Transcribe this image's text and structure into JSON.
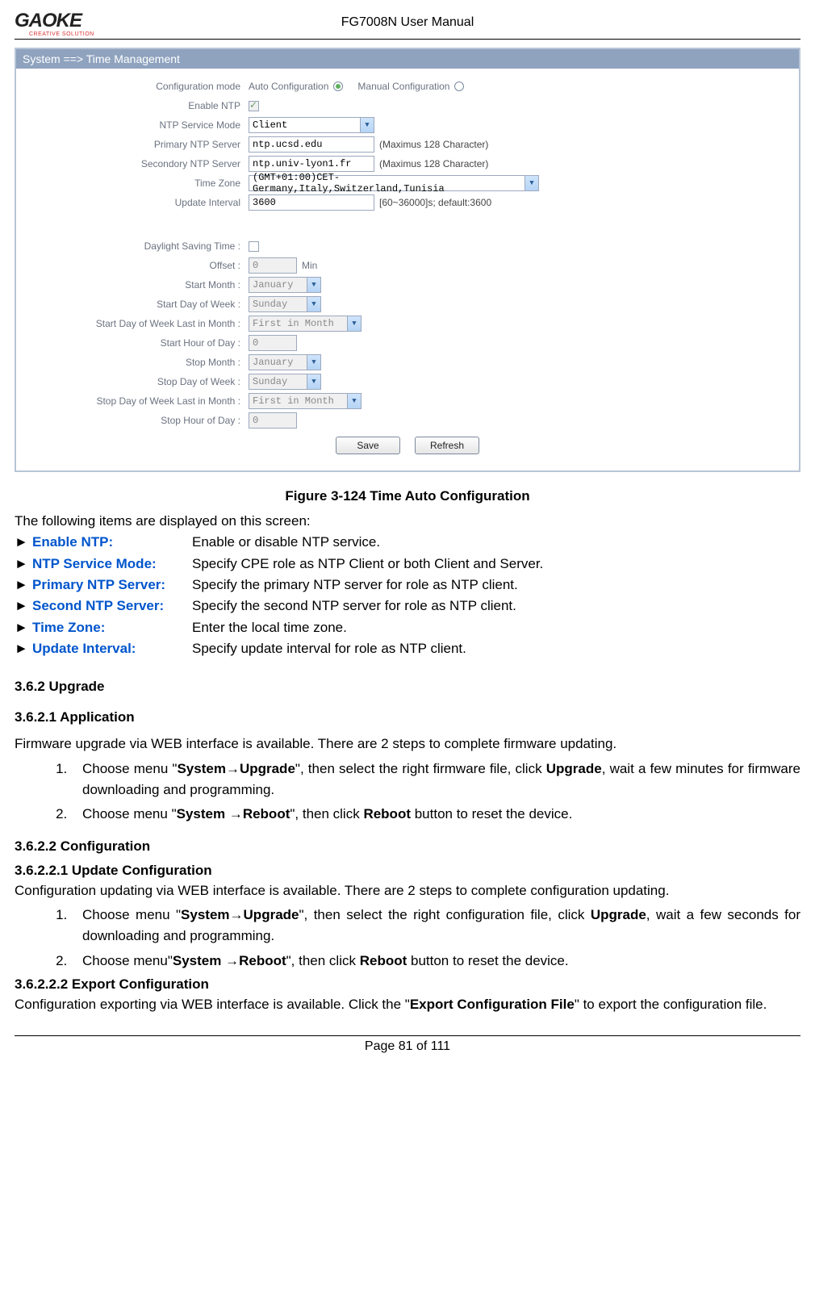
{
  "header": {
    "logo_main": "GAOKE",
    "logo_tag": "CREATIVE SOLUTION",
    "doc_title": "FG7008N User Manual"
  },
  "screenshot": {
    "titlebar": "System ==> Time Management",
    "rows": {
      "config_mode_label": "Configuration mode",
      "config_mode_opt1": "Auto Configuration",
      "config_mode_opt2": "Manual Configuration",
      "enable_ntp_label": "Enable NTP",
      "ntp_service_mode_label": "NTP Service Mode",
      "ntp_service_mode_value": "Client",
      "primary_ntp_label": "Primary NTP Server",
      "primary_ntp_value": "ntp.ucsd.edu",
      "primary_ntp_hint": "(Maximus 128 Character)",
      "secondary_ntp_label": "Secondory NTP Server",
      "secondary_ntp_value": "ntp.univ-lyon1.fr",
      "secondary_ntp_hint": "(Maximus 128 Character)",
      "timezone_label": "Time Zone",
      "timezone_value": "(GMT+01:00)CET-Germany,Italy,Switzerland,Tunisia",
      "update_interval_label": "Update Interval",
      "update_interval_value": "3600",
      "update_interval_hint": "[60~36000]s; default:3600",
      "dst_label": "Daylight Saving Time :",
      "offset_label": "Offset :",
      "offset_value": "0",
      "offset_unit": "Min",
      "start_month_label": "Start Month :",
      "start_month_value": "January",
      "start_dow_label": "Start Day of Week :",
      "start_dow_value": "Sunday",
      "start_dow_last_label": "Start Day of Week Last in Month :",
      "start_dow_last_value": "First in Month",
      "start_hour_label": "Start Hour of Day :",
      "start_hour_value": "0",
      "stop_month_label": "Stop Month :",
      "stop_month_value": "January",
      "stop_dow_label": "Stop Day of Week :",
      "stop_dow_value": "Sunday",
      "stop_dow_last_label": "Stop Day of Week Last in Month :",
      "stop_dow_last_value": "First in Month",
      "stop_hour_label": "Stop Hour of Day :",
      "stop_hour_value": "0"
    },
    "buttons": {
      "save": "Save",
      "refresh": "Refresh"
    }
  },
  "figure_caption": "Figure 3-124  Time Auto Configuration",
  "intro_line": "The following items are displayed on this screen:",
  "params": [
    {
      "name": "Enable NTP:",
      "desc": "Enable or disable NTP service."
    },
    {
      "name": "NTP Service Mode:",
      "desc": "Specify CPE role as NTP Client or both Client and Server."
    },
    {
      "name": "Primary NTP Server:",
      "desc": "Specify the primary NTP server for role as NTP client."
    },
    {
      "name": "Second NTP Server:",
      "desc": "Specify the second NTP server for role as NTP client."
    },
    {
      "name": "Time Zone:",
      "desc": "Enter the local time zone."
    },
    {
      "name": "Update Interval:",
      "desc": "Specify update interval for role as NTP client."
    }
  ],
  "sections": {
    "s362": "3.6.2    Upgrade",
    "s3621": "3.6.2.1      Application",
    "s3621_text": "Firmware upgrade via WEB interface is available. There are 2 steps to complete firmware updating.",
    "s3621_step1_a": "Choose menu \"",
    "s3621_step1_b": "System",
    "s3621_step1_c": "→",
    "s3621_step1_d": "Upgrade",
    "s3621_step1_e": "\", then select the right firmware file, click ",
    "s3621_step1_f": "Upgrade",
    "s3621_step1_g": ", wait a few minutes for firmware downloading and programming.",
    "s3621_step2_a": "Choose menu \"",
    "s3621_step2_b": "System ",
    "s3621_step2_c": "→",
    "s3621_step2_d": "Reboot",
    "s3621_step2_e": "\", then click ",
    "s3621_step2_f": "Reboot",
    "s3621_step2_g": " button to reset the device.",
    "s3622": "3.6.2.2      Configuration",
    "s36221": "3.6.2.2.1 Update Configuration",
    "s36221_text": "Configuration updating via WEB interface is available. There are 2 steps to complete configuration updating.",
    "s36221_step1_a": "Choose menu \"",
    "s36221_step1_b": "System",
    "s36221_step1_c": "→",
    "s36221_step1_d": "Upgrade",
    "s36221_step1_e": "\", then select the right configuration file, click ",
    "s36221_step1_f": "Upgrade",
    "s36221_step1_g": ", wait a few seconds for downloading and programming.",
    "s36221_step2_a": "Choose menu\"",
    "s36221_step2_b": "System ",
    "s36221_step2_c": "→",
    "s36221_step2_d": "Reboot",
    "s36221_step2_e": "\", then click ",
    "s36221_step2_f": "Reboot",
    "s36221_step2_g": " button to reset the device.",
    "s36222": "3.6.2.2.2 Export Configuration",
    "s36222_text_a": "Configuration exporting via WEB interface is available. Click the \"",
    "s36222_text_b": "Export Configuration File",
    "s36222_text_c": "\" to export the configuration file."
  },
  "footer": "Page 81 of 111"
}
